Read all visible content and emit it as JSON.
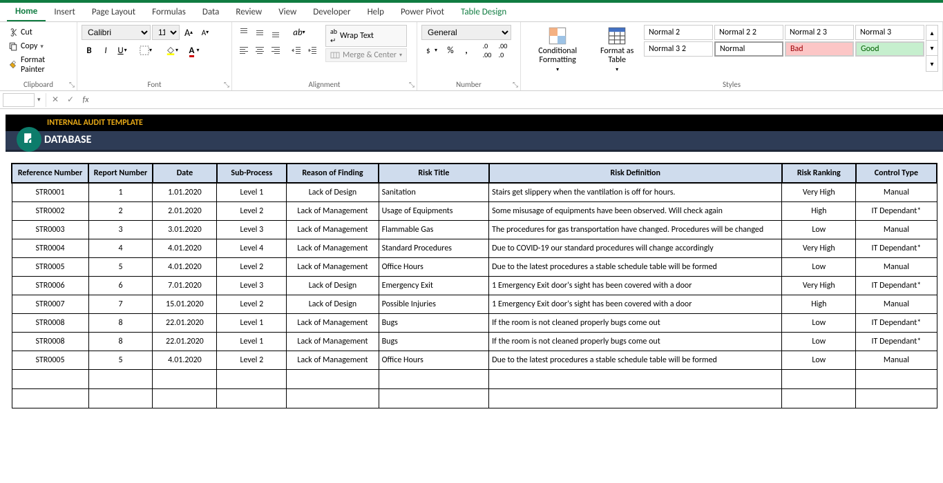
{
  "tabs": {
    "home": "Home",
    "insert": "Insert",
    "page_layout": "Page Layout",
    "formulas": "Formulas",
    "data": "Data",
    "review": "Review",
    "view": "View",
    "developer": "Developer",
    "help": "Help",
    "power_pivot": "Power Pivot",
    "table_design": "Table Design"
  },
  "ribbon": {
    "clipboard": {
      "label": "Clipboard",
      "cut": "Cut",
      "copy": "Copy",
      "format_painter": "Format Painter"
    },
    "font": {
      "label": "Font",
      "name": "Calibri",
      "size": "11"
    },
    "alignment": {
      "label": "Alignment",
      "wrap": "Wrap Text",
      "merge": "Merge & Center"
    },
    "number": {
      "label": "Number",
      "format": "General"
    },
    "styles": {
      "label": "Styles",
      "conditional": "Conditional Formatting",
      "format_table": "Format as Table",
      "row1": [
        "Normal 2",
        "Normal 2 2",
        "Normal 2 3",
        "Normal 3"
      ],
      "row2": [
        "Normal 3 2",
        "Normal",
        "Bad",
        "Good"
      ],
      "colors": {
        "Normal": {
          "bg": "#fff",
          "border": "#9c9c9c"
        },
        "Bad": {
          "bg": "#fcc6c6",
          "color": "#9c0006"
        },
        "Good": {
          "bg": "#c6efce",
          "color": "#006100"
        }
      }
    }
  },
  "banner": {
    "suptitle": "INTERNAL AUDIT TEMPLATE",
    "title": "DATABASE"
  },
  "table": {
    "headers": [
      "Reference Number",
      "Report Number",
      "Date",
      "Sub-Process",
      "Reason of Finding",
      "Risk Title",
      "Risk Definition",
      "Risk Ranking",
      "Control Type"
    ],
    "rows": [
      {
        "ref": "STR0001",
        "rep": "1",
        "date": "1.01.2020",
        "sub": "Level 1",
        "reason": "Lack of Design",
        "title": "Sanitation",
        "def": "Stairs get slippery when the vantilation is off for hours.",
        "rank": "Very High",
        "ctrl": "Manual"
      },
      {
        "ref": "STR0002",
        "rep": "2",
        "date": "2.01.2020",
        "sub": "Level 2",
        "reason": "Lack of Management",
        "title": "Usage of Equipments",
        "def": "Some misusage of equipments have been observed. Will check again",
        "rank": "High",
        "ctrl": "IT Dependant*"
      },
      {
        "ref": "STR0003",
        "rep": "3",
        "date": "3.01.2020",
        "sub": "Level 3",
        "reason": "Lack of Management",
        "title": "Flammable Gas",
        "def": "The procedures for gas transportation have changed. Procedures will be changed",
        "rank": "Low",
        "ctrl": "Manual"
      },
      {
        "ref": "STR0004",
        "rep": "4",
        "date": "4.01.2020",
        "sub": "Level 4",
        "reason": "Lack of Management",
        "title": "Standard Procedures",
        "def": "Due to COVID-19 our standard procedures will change accordingly",
        "rank": "Very High",
        "ctrl": "IT Dependant*"
      },
      {
        "ref": "STR0005",
        "rep": "5",
        "date": "4.01.2020",
        "sub": "Level 2",
        "reason": "Lack of Management",
        "title": "Office Hours",
        "def": "Due to the latest procedures a stable schedule table will be formed",
        "rank": "Low",
        "ctrl": "Manual"
      },
      {
        "ref": "STR0006",
        "rep": "6",
        "date": "7.01.2020",
        "sub": "Level 3",
        "reason": "Lack of Design",
        "title": "Emergency Exit",
        "def": "1 Emergency Exit door's sight has been covered with a door",
        "rank": "Very High",
        "ctrl": "IT Dependant*"
      },
      {
        "ref": "STR0007",
        "rep": "7",
        "date": "15.01.2020",
        "sub": "Level 2",
        "reason": "Lack of Design",
        "title": "Possible Injuries",
        "def": "1 Emergency Exit door's sight has been covered with a door",
        "rank": "High",
        "ctrl": "Manual"
      },
      {
        "ref": "STR0008",
        "rep": "8",
        "date": "22.01.2020",
        "sub": "Level 1",
        "reason": "Lack of Management",
        "title": "Bugs",
        "def": "If the room is not cleaned properly bugs come out",
        "rank": "Low",
        "ctrl": "IT Dependant*"
      },
      {
        "ref": "STR0008",
        "rep": "8",
        "date": "22.01.2020",
        "sub": "Level 1",
        "reason": "Lack of Management",
        "title": "Bugs",
        "def": "If the room is not cleaned properly bugs come out",
        "rank": "Low",
        "ctrl": "IT Dependant*"
      },
      {
        "ref": "STR0005",
        "rep": "5",
        "date": "4.01.2020",
        "sub": "Level 2",
        "reason": "Lack of Management",
        "title": "Office Hours",
        "def": "Due to the latest procedures a stable schedule table will be formed",
        "rank": "Low",
        "ctrl": "Manual"
      }
    ],
    "empty_rows": 2
  }
}
